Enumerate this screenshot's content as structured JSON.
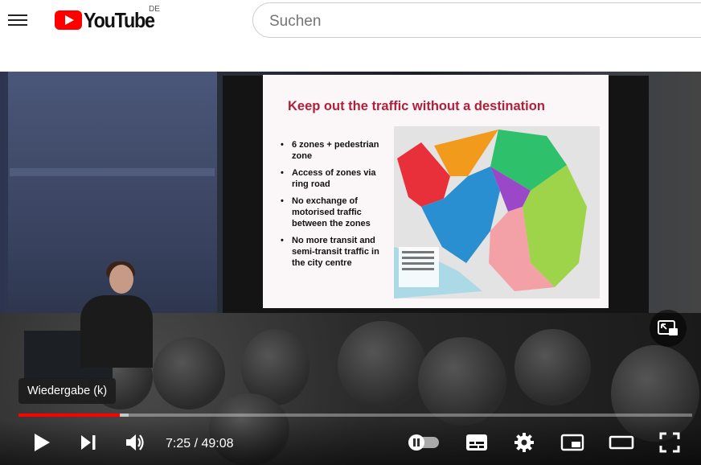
{
  "header": {
    "logo_text": "YouTube",
    "region": "DE",
    "search_placeholder": "Suchen",
    "icons": [
      "menu-icon",
      "youtube-logo-icon"
    ]
  },
  "slide": {
    "title": "Keep out the traffic without a destination",
    "bullets": [
      "6 zones + pedestrian zone",
      "Access of zones via ring road",
      "No exchange of motorised traffic between the zones",
      "No more transit and semi-transit traffic in the city centre"
    ]
  },
  "player": {
    "tooltip": "Wiedergabe (k)",
    "time": "7:25 / 49:08",
    "progress_fraction": 0.151,
    "loaded_fraction": 0.164,
    "colors": {
      "progress": "#ff0000",
      "accent": "#ff0000"
    },
    "icons": [
      "play-icon",
      "next-icon",
      "volume-icon",
      "autoplay-toggle-icon",
      "subtitles-icon",
      "settings-icon",
      "miniplayer-icon",
      "theater-mode-icon",
      "fullscreen-icon",
      "pip-icon"
    ]
  }
}
